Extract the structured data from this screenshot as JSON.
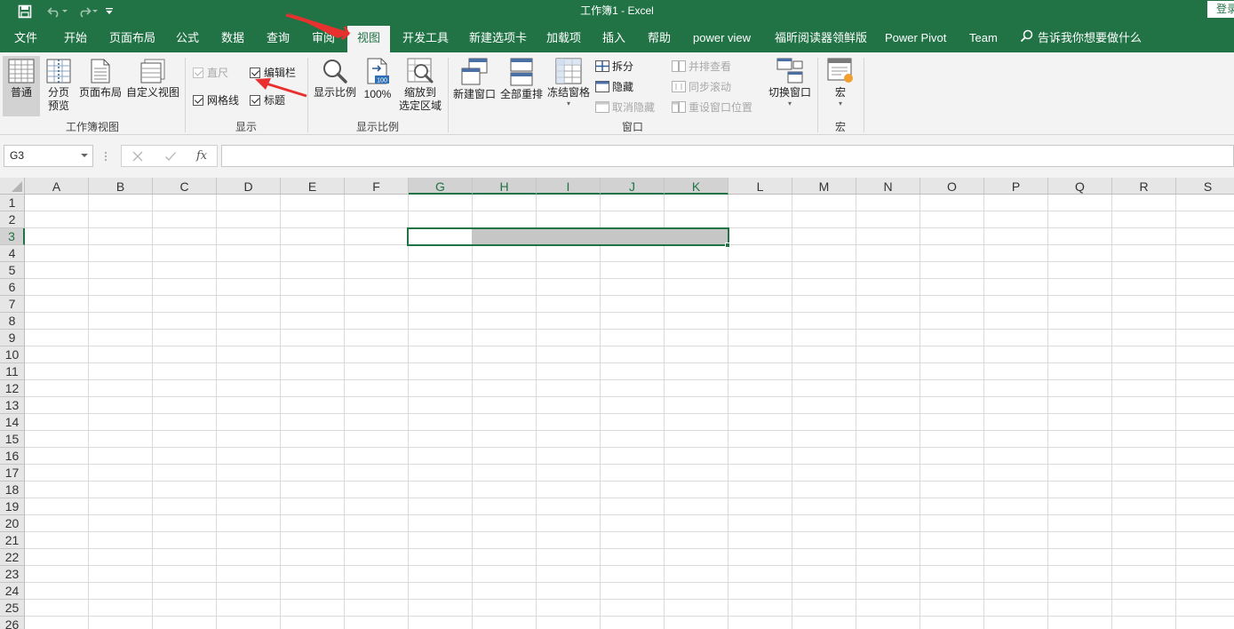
{
  "titlebar": {
    "title": "工作簿1  -  Excel",
    "login": "登录",
    "qat": [
      "save-icon",
      "undo-icon",
      "redo-icon",
      "customize-qat-icon"
    ]
  },
  "tabs": [
    {
      "label": "文件"
    },
    {
      "label": "开始"
    },
    {
      "label": "页面布局"
    },
    {
      "label": "公式"
    },
    {
      "label": "数据"
    },
    {
      "label": "查询"
    },
    {
      "label": "审阅"
    },
    {
      "label": "视图",
      "active": true
    },
    {
      "label": "开发工具"
    },
    {
      "label": "新建选项卡"
    },
    {
      "label": "加载项"
    },
    {
      "label": "插入"
    },
    {
      "label": "帮助"
    },
    {
      "label": "power view"
    },
    {
      "label": "福昕阅读器领鲜版"
    },
    {
      "label": "Power Pivot"
    },
    {
      "label": "Team"
    }
  ],
  "tell_me": "告诉我你想要做什么",
  "ribbon": {
    "workbook_views": {
      "label": "工作簿视图",
      "normal": "普通",
      "page_break_1": "分页",
      "page_break_2": "预览",
      "page_layout": "页面布局",
      "custom_views": "自定义视图"
    },
    "show": {
      "label": "显示",
      "ruler": "直尺",
      "formula_bar": "编辑栏",
      "gridlines": "网格线",
      "headings": "标题"
    },
    "zoom": {
      "label": "显示比例",
      "zoom": "显示比例",
      "hundred": "100%",
      "zoom_sel_1": "缩放到",
      "zoom_sel_2": "选定区域",
      "badge": "100"
    },
    "window": {
      "label": "窗口",
      "new_window": "新建窗口",
      "arrange_all": "全部重排",
      "freeze_panes": "冻结窗格",
      "split": "拆分",
      "hide": "隐藏",
      "unhide": "取消隐藏",
      "side_by_side": "并排查看",
      "sync_scroll": "同步滚动",
      "reset_position": "重设窗口位置",
      "switch_windows": "切换窗口"
    },
    "macros": {
      "label": "宏",
      "macros": "宏"
    }
  },
  "formula_bar": {
    "name_box": "G3",
    "formula": ""
  },
  "sheet": {
    "columns": [
      "A",
      "B",
      "C",
      "D",
      "E",
      "F",
      "G",
      "H",
      "I",
      "J",
      "K",
      "L",
      "M",
      "N",
      "O",
      "P",
      "Q",
      "R",
      "S"
    ],
    "rows": [
      "1",
      "2",
      "3",
      "4",
      "5",
      "6",
      "7",
      "8",
      "9",
      "10",
      "11",
      "12",
      "13",
      "14",
      "15",
      "16",
      "17",
      "18",
      "19",
      "20",
      "21",
      "22",
      "23",
      "24",
      "25",
      "26"
    ],
    "selected_range": "G3:K3",
    "active_cell": "G3"
  },
  "colors": {
    "accent": "#217346",
    "annotation_arrow": "#e8302f"
  }
}
